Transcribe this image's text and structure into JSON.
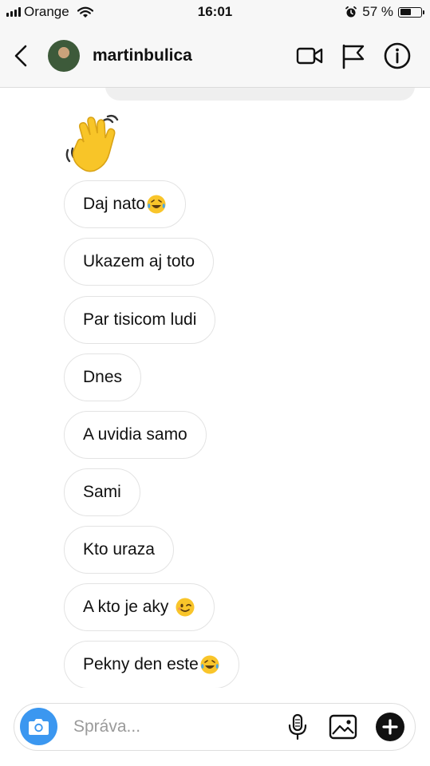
{
  "status_bar": {
    "carrier": "Orange",
    "time": "16:01",
    "battery_text": "57 %",
    "battery_level": 0.57,
    "icons": [
      "signal-icon",
      "wifi-icon",
      "alarm-icon",
      "battery-icon"
    ]
  },
  "header": {
    "username": "martinbulica",
    "icons": [
      "back-chevron-icon",
      "avatar",
      "video-call-icon",
      "flag-icon",
      "info-icon"
    ]
  },
  "thread": {
    "sticker": "waving-hand",
    "messages": [
      {
        "text": "Daj nato",
        "emoji": "laughing-tears"
      },
      {
        "text": "Ukazem aj toto",
        "emoji": ""
      },
      {
        "text": "Par tisicom ludi",
        "emoji": ""
      },
      {
        "text": "Dnes",
        "emoji": ""
      },
      {
        "text": "A uvidia samo",
        "emoji": ""
      },
      {
        "text": "Sami",
        "emoji": ""
      },
      {
        "text": "Kto uraza",
        "emoji": ""
      },
      {
        "text": "A kto je aky",
        "emoji": "winking-face"
      },
      {
        "text": "Pekny den este",
        "emoji": "laughing-tears"
      }
    ]
  },
  "composer": {
    "placeholder": "Správa...",
    "value": "",
    "icons": [
      "camera-icon",
      "microphone-icon",
      "gallery-icon",
      "plus-icon"
    ],
    "camera_color": "#3b97f0"
  }
}
